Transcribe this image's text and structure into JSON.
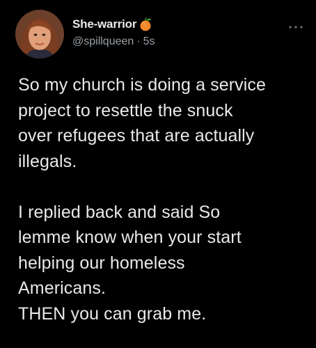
{
  "author": {
    "display_name": "She-warrior",
    "name_emoji_icon": "peach-icon",
    "handle": "@spillqueen",
    "separator": "·",
    "timestamp": "5s",
    "avatar_icon": "profile-photo"
  },
  "menu": {
    "icon": "more-options-icon"
  },
  "tweet": {
    "lines": [
      "So my church is doing a service",
      "project to resettle the snuck",
      "over refugees that are actually",
      "illegals.",
      "",
      "I replied back and said So",
      "lemme know when your start",
      "helping our homeless",
      "Americans.",
      "THEN you can grab me."
    ]
  },
  "colors": {
    "background": "#000000",
    "text": "#e7e9ea",
    "secondary_text": "#9aa0a6"
  }
}
